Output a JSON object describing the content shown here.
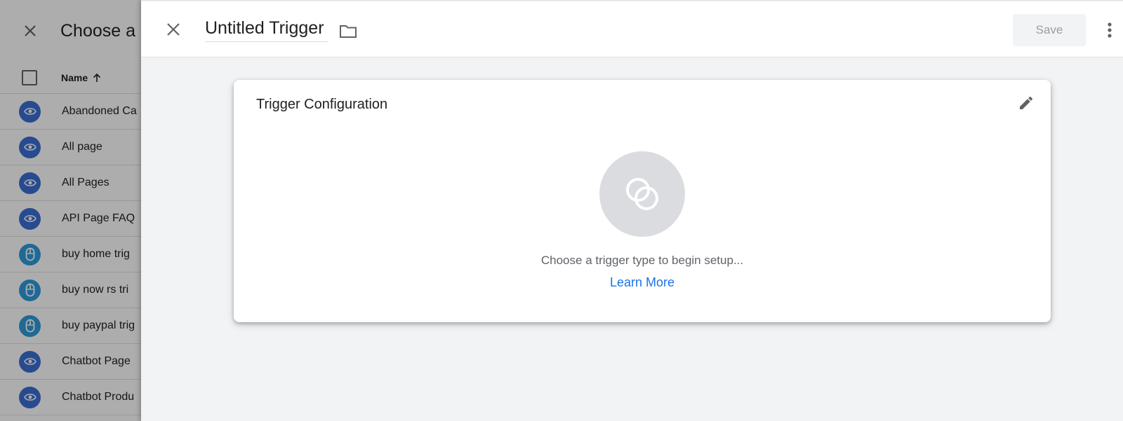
{
  "background_panel": {
    "title": "Choose a",
    "column_header": "Name",
    "rows": [
      {
        "label": "Abandoned Ca",
        "icon": "eye-icon"
      },
      {
        "label": "All page",
        "icon": "eye-icon"
      },
      {
        "label": "All Pages",
        "icon": "eye-icon"
      },
      {
        "label": "API Page FAQ",
        "icon": "eye-icon"
      },
      {
        "label": "buy home trig",
        "icon": "mouse-icon"
      },
      {
        "label": "buy now rs tri",
        "icon": "mouse-icon"
      },
      {
        "label": "buy paypal trig",
        "icon": "mouse-icon"
      },
      {
        "label": "Chatbot Page",
        "icon": "eye-icon"
      },
      {
        "label": "Chatbot Produ",
        "icon": "eye-icon"
      }
    ]
  },
  "header": {
    "title_value": "Untitled Trigger",
    "save_label": "Save"
  },
  "card": {
    "title": "Trigger Configuration",
    "hint": "Choose a trigger type to begin setup...",
    "learn_more": "Learn More"
  },
  "colors": {
    "accent": "#1a73e8",
    "eye_icon_bg": "#3b6fd4",
    "mouse_icon_bg": "#2f9bdc"
  }
}
